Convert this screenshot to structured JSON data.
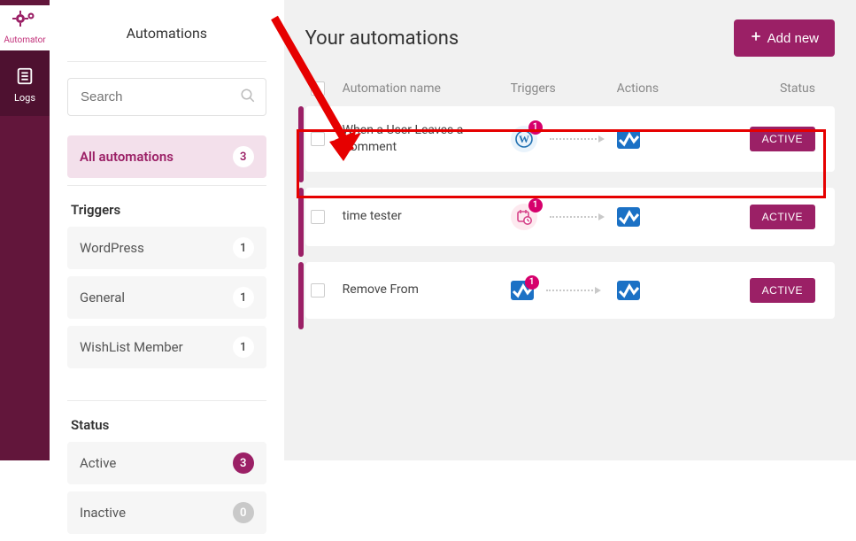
{
  "rail": {
    "logo_label": "Automator",
    "items": [
      {
        "label": "Logs"
      }
    ]
  },
  "sidebar": {
    "title": "Automations",
    "search_placeholder": "Search",
    "all_label": "All automations",
    "all_count": "3",
    "triggers_title": "Triggers",
    "triggers": [
      {
        "label": "WordPress",
        "count": "1"
      },
      {
        "label": "General",
        "count": "1"
      },
      {
        "label": "WishList Member",
        "count": "1"
      }
    ],
    "status_title": "Status",
    "statuses": [
      {
        "label": "Active",
        "count": "3",
        "style": "dark"
      },
      {
        "label": "Inactive",
        "count": "0",
        "style": "grey"
      }
    ]
  },
  "main": {
    "title": "Your automations",
    "add_label": "Add new",
    "columns": {
      "name": "Automation name",
      "triggers": "Triggers",
      "actions": "Actions",
      "status": "Status"
    },
    "rows": [
      {
        "name": "When a User Leaves a Comment",
        "trigger_type": "wp",
        "trigger_count": "1",
        "status": "ACTIVE"
      },
      {
        "name": "time tester",
        "trigger_type": "time",
        "trigger_count": "1",
        "status": "ACTIVE"
      },
      {
        "name": "Remove From",
        "trigger_type": "sq",
        "trigger_count": "1",
        "status": "ACTIVE"
      }
    ]
  }
}
